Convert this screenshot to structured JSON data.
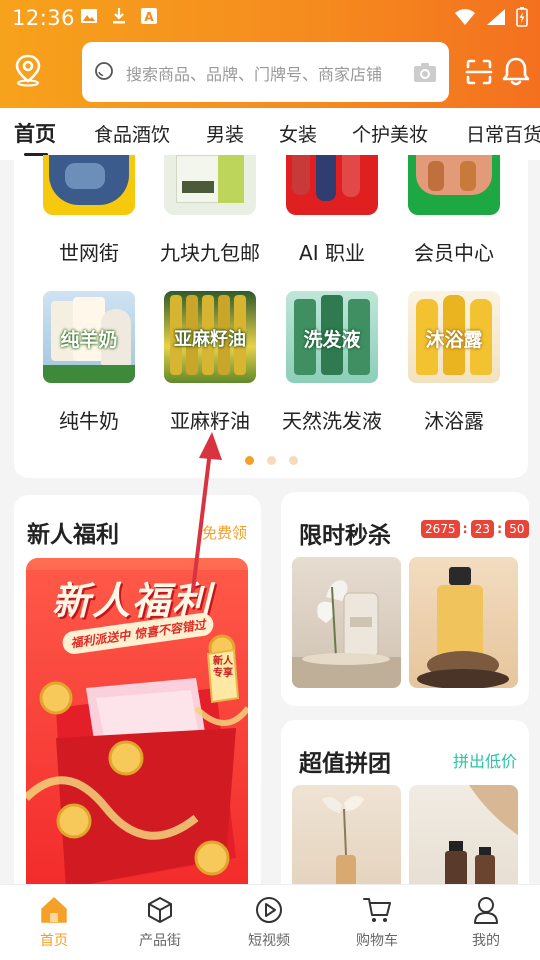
{
  "status_bar": {
    "time": "12:36"
  },
  "search": {
    "placeholder": "搜索商品、品牌、门牌号、商家店铺"
  },
  "tabs": [
    "首页",
    "食品酒饮",
    "男装",
    "女装",
    "个护美妆",
    "日常百货"
  ],
  "grid": {
    "row1": [
      "世网街",
      "九块九包邮",
      "AI 职业",
      "会员中心"
    ],
    "row2": [
      {
        "label": "纯牛奶",
        "img_text": "纯羊奶"
      },
      {
        "label": "亚麻籽油",
        "img_text": "亚麻籽油"
      },
      {
        "label": "天然洗发液",
        "img_text": "洗发液"
      },
      {
        "label": "沐浴露",
        "img_text": "沐浴露"
      }
    ],
    "page_count": 3,
    "active_page": 0
  },
  "new_user": {
    "title": "新人福利",
    "link": "免费领",
    "banner_title": "新人福利",
    "banner_subtitle": "福利派送中 惊喜不容错过",
    "banner_tag": "新人专享"
  },
  "flash_sale": {
    "title": "限时秒杀",
    "timer": [
      "2675",
      "23",
      "50"
    ]
  },
  "group_buy": {
    "title": "超值拼团",
    "link": "拼出低价"
  },
  "bottom_nav": [
    {
      "label": "首页",
      "icon": "home-icon",
      "active": true
    },
    {
      "label": "产品街",
      "icon": "cube-icon",
      "active": false
    },
    {
      "label": "短视频",
      "icon": "play-icon",
      "active": false
    },
    {
      "label": "购物车",
      "icon": "cart-icon",
      "active": false
    },
    {
      "label": "我的",
      "icon": "user-icon",
      "active": false
    }
  ],
  "colors": {
    "brand_orange": "#f5a028",
    "header_start": "#f7a21c",
    "header_end": "#f4701f",
    "timer_red": "#e84538",
    "group_link": "#2bc4a6",
    "annotation_arrow": "#d9333f"
  }
}
